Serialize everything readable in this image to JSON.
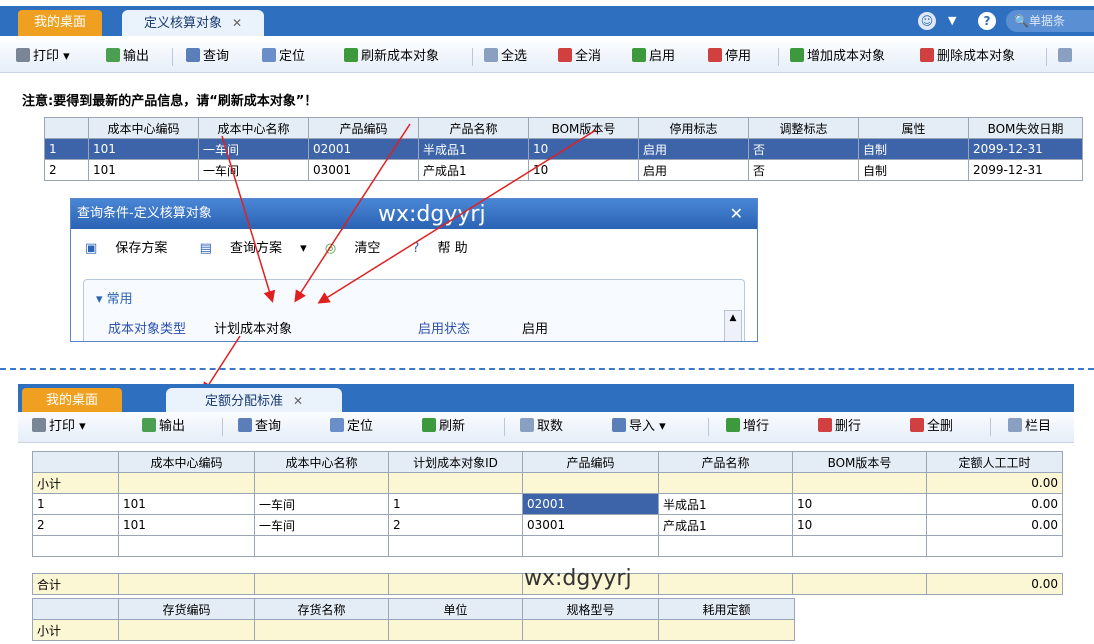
{
  "top": {
    "tabs": {
      "home": "我的桌面",
      "active": "定义核算对象"
    },
    "search_placeholder": "单据条",
    "toolbar": {
      "print": "打印",
      "export": "输出",
      "query": "查询",
      "locate": "定位",
      "refresh_objects": "刷新成本对象",
      "select_all": "全选",
      "clear_all": "全消",
      "enable": "启用",
      "disable": "停用",
      "add_object": "增加成本对象",
      "delete_object": "删除成本对象"
    },
    "notice": "注意:要得到最新的产品信息，请“刷新成本对象”！",
    "grid": {
      "headers": [
        "成本中心编码",
        "成本中心名称",
        "产品编码",
        "产品名称",
        "BOM版本号",
        "停用标志",
        "调整标志",
        "属性",
        "BOM失效日期"
      ],
      "rows": [
        [
          "1",
          "101",
          "一车间",
          "02001",
          "半成品1",
          "10",
          "启用",
          "否",
          "自制",
          "2099-12-31"
        ],
        [
          "2",
          "101",
          "一车间",
          "03001",
          "产成品1",
          "10",
          "启用",
          "否",
          "自制",
          "2099-12-31"
        ]
      ]
    }
  },
  "dialog": {
    "title": "查询条件-定义核算对象",
    "save_scheme": "保存方案",
    "query_scheme": "查询方案",
    "clear": "清空",
    "help": "帮 助",
    "group": "常用",
    "field1_label": "成本对象类型",
    "field1_value": "计划成本对象",
    "field2_label": "启用状态",
    "field2_value": "启用"
  },
  "watermark": "wx:dgyyrj",
  "bottom": {
    "tabs": {
      "home": "我的桌面",
      "active": "定额分配标准"
    },
    "toolbar": {
      "print": "打印",
      "export": "输出",
      "query": "查询",
      "locate": "定位",
      "refresh": "刷新",
      "fetch": "取数",
      "import": "导入",
      "add_row": "增行",
      "delete_row": "删行",
      "delete_all": "全删",
      "columns": "栏目"
    },
    "grid": {
      "headers": [
        "成本中心编码",
        "成本中心名称",
        "计划成本对象ID",
        "产品编码",
        "产品名称",
        "BOM版本号",
        "定额人工工时"
      ],
      "subtotal": "小计",
      "subtotal_value": "0.00",
      "rows": [
        [
          "1",
          "101",
          "一车间",
          "1",
          "02001",
          "半成品1",
          "10",
          "0.00"
        ],
        [
          "2",
          "101",
          "一车间",
          "2",
          "03001",
          "产成品1",
          "10",
          "0.00"
        ]
      ],
      "total": "合计",
      "total_value": "0.00"
    },
    "grid2": {
      "headers": [
        "存货编码",
        "存货名称",
        "单位",
        "规格型号",
        "耗用定额"
      ],
      "subtotal": "小计"
    }
  }
}
